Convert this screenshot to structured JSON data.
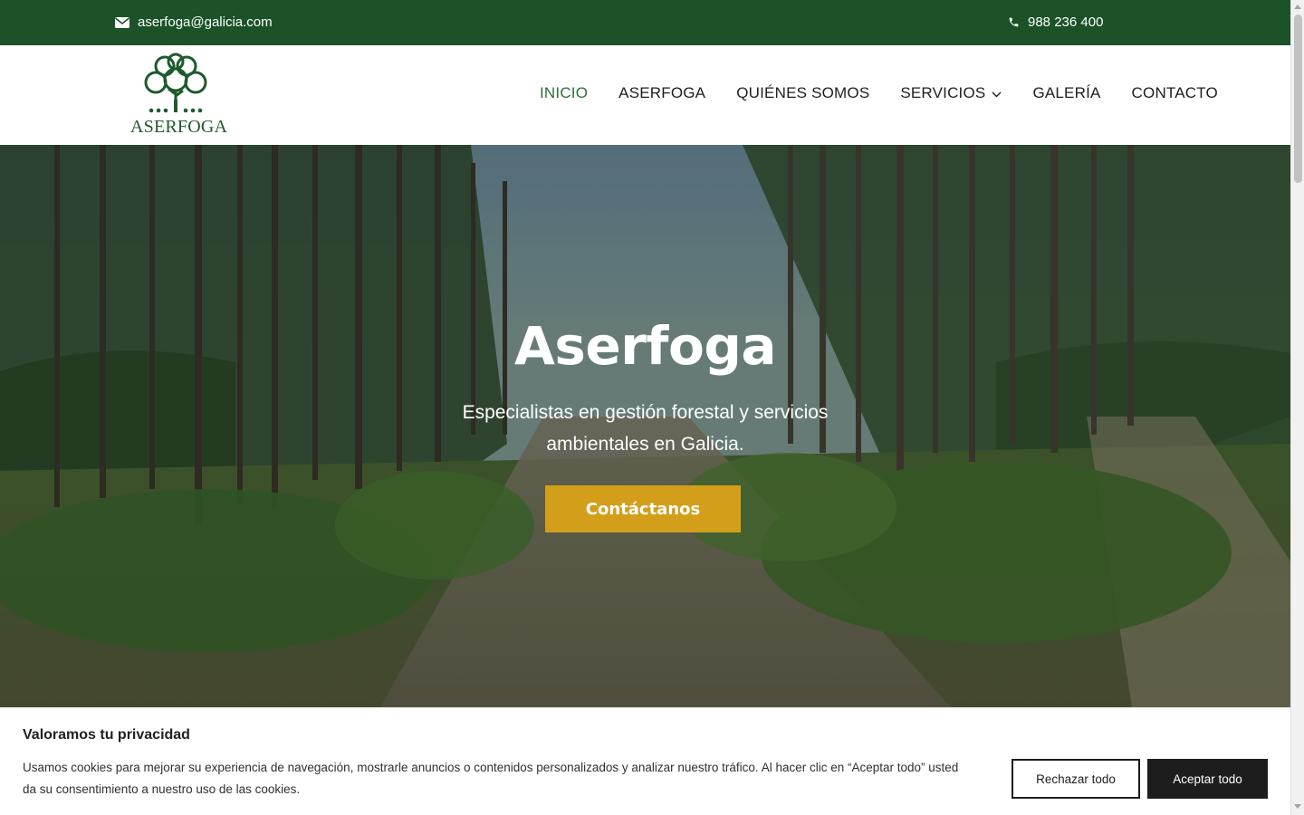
{
  "topbar": {
    "email": "aserfoga@galicia.com",
    "email_icon": "envelope-icon",
    "phone": "988 236 400",
    "phone_icon": "phone-icon",
    "background": "#1b5228"
  },
  "header": {
    "logo_text": "ASERFOGA",
    "logo_icon": "tree-logo-icon",
    "nav": [
      {
        "label": "INICIO",
        "active": true
      },
      {
        "label": "ASERFOGA"
      },
      {
        "label": "QUIÉNES SOMOS"
      },
      {
        "label": "SERVICIOS",
        "icon": "chevron-down-icon"
      },
      {
        "label": "GALERÍA"
      },
      {
        "label": "CONTACTO"
      }
    ],
    "active_color": "#2a6e35"
  },
  "hero": {
    "title": "Aserfoga",
    "subtitle": "Especialistas en gestión forestal y servicios ambientales en Galicia.",
    "cta": "Contáctanos",
    "cta_color": "#d39e19"
  },
  "cookie": {
    "title": "Valoramos tu privacidad",
    "text": "Usamos cookies para mejorar su experiencia de navegación, mostrarle anuncios o contenidos personalizados y analizar nuestro tráfico. Al hacer clic en “Aceptar todo” usted da su consentimiento a nuestro uso de las cookies.",
    "reject": "Rechazar todo",
    "accept": "Aceptar todo"
  }
}
